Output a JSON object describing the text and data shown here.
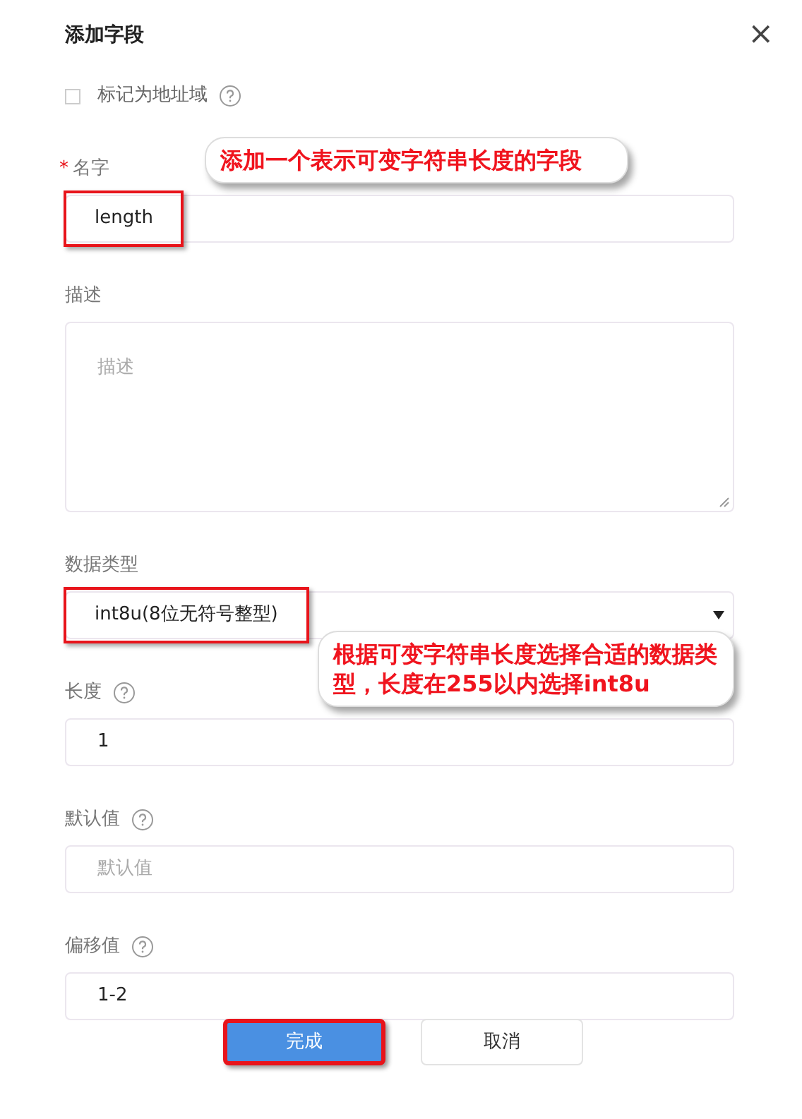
{
  "dialog": {
    "title": "添加字段",
    "close": "×"
  },
  "address_checkbox": {
    "label": "标记为地址域",
    "checked": false
  },
  "fields": [
    {
      "kind": "input",
      "label": "名字",
      "required_mark": "*",
      "help": false,
      "value": "length",
      "highlighted": true
    },
    {
      "kind": "textarea",
      "label": "描述",
      "help": false,
      "placeholder": "描述",
      "highlighted": false
    },
    {
      "kind": "select",
      "label": "数据类型",
      "help": false,
      "value": "int8u(8位无符号整型)",
      "highlighted": true
    },
    {
      "kind": "input",
      "label": "长度",
      "help": true,
      "value": "1",
      "highlighted": false
    },
    {
      "kind": "input",
      "label": "默认值",
      "help": true,
      "placeholder": "默认值",
      "highlighted": false
    },
    {
      "kind": "input",
      "label": "偏移值",
      "help": true,
      "value": "1-2",
      "highlighted": false
    }
  ],
  "buttons": [
    {
      "label": "完成",
      "kind": "primary",
      "highlighted": true
    },
    {
      "label": "取消",
      "kind": "secondary",
      "highlighted": false
    }
  ],
  "annotations": [
    {
      "text": "添加一个表示可变字符串长度的字段",
      "kind": "name"
    },
    {
      "text": "根据可变字符串长度选择合适的数据类型，长度在255以内选择int8u",
      "kind": "type"
    }
  ]
}
